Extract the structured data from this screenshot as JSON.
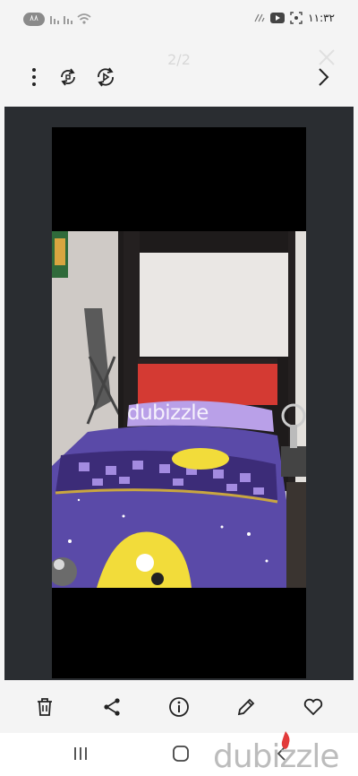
{
  "status_bar": {
    "battery_level": "٨٨",
    "time": "١١:٣٢"
  },
  "viewer_header": {
    "image_counter": "2/2",
    "icons": [
      "more-vertical-icon",
      "rotate-icon",
      "autoplay-icon",
      "close-icon",
      "next-arrow-icon"
    ]
  },
  "photo": {
    "watermark": "dubizzle",
    "description": "bed with purple bedspread and red headboard"
  },
  "action_bar": {
    "icons": [
      "trash-icon",
      "share-icon",
      "info-icon",
      "edit-icon",
      "heart-icon"
    ]
  },
  "nav_bar": {
    "icons": [
      "recents-icon",
      "home-icon",
      "back-icon"
    ],
    "watermark": "dubizzle"
  },
  "colors": {
    "background": "#f4f4f4",
    "viewer": "#2a2d31",
    "headboard": "#d43a33",
    "bedspread": "#5a4aa8",
    "pillow": "#b9a0e8"
  }
}
